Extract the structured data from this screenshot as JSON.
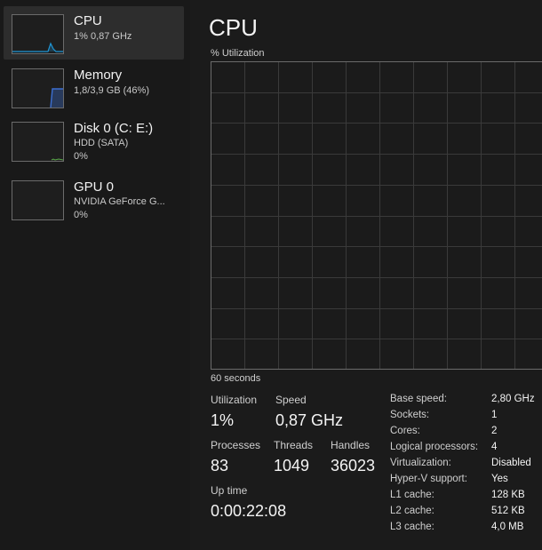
{
  "sidebar": {
    "items": [
      {
        "title": "CPU",
        "line1": "1% 0,87 GHz",
        "line2": "",
        "color": "#1f96d6"
      },
      {
        "title": "Memory",
        "line1": "1,8/3,9 GB (46%)",
        "line2": "",
        "color": "#3c6fd1"
      },
      {
        "title": "Disk 0 (C: E:)",
        "line1": "HDD (SATA)",
        "line2": "0%",
        "color": "#5ba94a"
      },
      {
        "title": "GPU 0",
        "line1": "NVIDIA GeForce G...",
        "line2": "0%",
        "color": "#8c5ad6"
      }
    ]
  },
  "main": {
    "title": "CPU",
    "graph_label": "% Utilization",
    "axis_time": "60 seconds",
    "stats": {
      "utilization_label": "Utilization",
      "utilization_value": "1%",
      "speed_label": "Speed",
      "speed_value": "0,87 GHz",
      "processes_label": "Processes",
      "processes_value": "83",
      "threads_label": "Threads",
      "threads_value": "1049",
      "handles_label": "Handles",
      "handles_value": "36023",
      "uptime_label": "Up time",
      "uptime_value": "0:00:22:08"
    },
    "specs": [
      {
        "label": "Base speed:",
        "value": "2,80 GHz"
      },
      {
        "label": "Sockets:",
        "value": "1"
      },
      {
        "label": "Cores:",
        "value": "2"
      },
      {
        "label": "Logical processors:",
        "value": "4"
      },
      {
        "label": "Virtualization:",
        "value": "Disabled"
      },
      {
        "label": "Hyper-V support:",
        "value": "Yes"
      },
      {
        "label": "L1 cache:",
        "value": "128 KB"
      },
      {
        "label": "L2 cache:",
        "value": "512 KB"
      },
      {
        "label": "L3 cache:",
        "value": "4,0 MB"
      }
    ]
  },
  "colors": {
    "grid": "#3a3a3a",
    "graph_border": "#6b6b6b",
    "cpu_accent": "#1f96d6"
  }
}
